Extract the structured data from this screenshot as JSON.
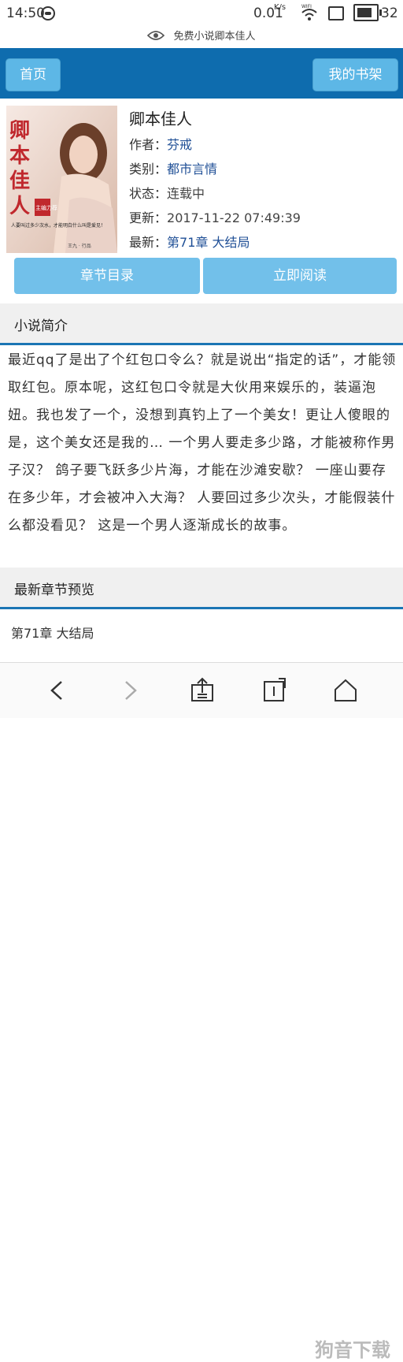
{
  "status": {
    "time": "14:50",
    "speed": "0.01",
    "speed_unit": "K/s",
    "wifi_label": "WIFI",
    "battery_level": "32"
  },
  "url_bar": {
    "text": "免费小说卿本佳人"
  },
  "header": {
    "home_label": "首页",
    "shelf_label": "我的书架"
  },
  "book": {
    "cover_title": "卿本佳人",
    "cover_small": "主编力荐",
    "cover_tagline": "人要叫过多少次水，才能明白什么叫是爱见！",
    "cover_footer": "王九 · 行品",
    "title": "卿本佳人",
    "author_label": "作者：",
    "author": "芬戒",
    "category_label": "类别：",
    "category": "都市言情",
    "state_label": "状态：",
    "state": "连载中",
    "updated_label": "更新：",
    "updated": "2017-11-22 07:49:39",
    "latest_label": "最新：",
    "latest": "第71章 大结局"
  },
  "actions": {
    "toc_label": "章节目录",
    "read_label": "立即阅读"
  },
  "intro": {
    "heading": "小说简介",
    "text": "最近qq了是出了个红包口令么？就是说出“指定的话”，才能领取红包。原本呢，这红包口令就是大伙用来娱乐的，装逼泡妞。我也发了一个，没想到真钓上了一个美女！更让人傻眼的是，这个美女还是我的… 一个男人要走多少路，才能被称作男子汉？ 鸽子要飞跃多少片海，才能在沙滩安歇？ 一座山要存在多少年，才会被冲入大海？ 人要回过多少次头，才能假装什么都没看见？ 这是一个男人逐渐成长的故事。"
  },
  "latest_section": {
    "heading": "最新章节预览",
    "item": "第71章 大结局"
  },
  "watermark": "狗音下载",
  "bottom_nav": {
    "icons": [
      "back-icon",
      "forward-icon",
      "share-icon",
      "bookmark-icon",
      "home-icon"
    ]
  }
}
